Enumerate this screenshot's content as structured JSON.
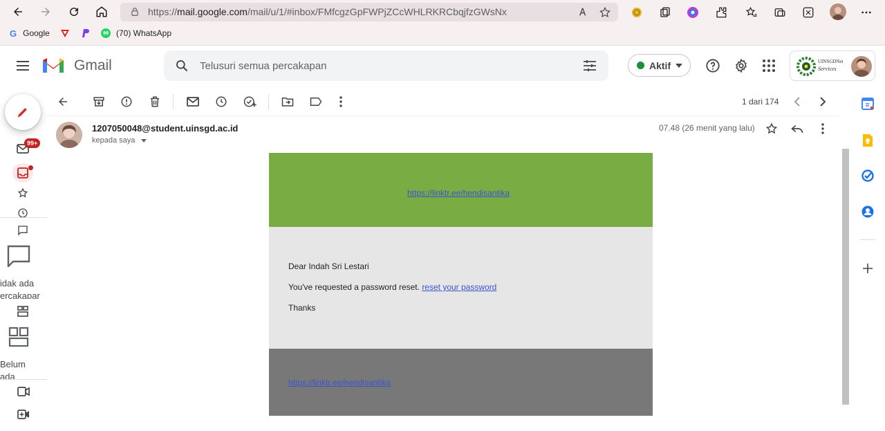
{
  "browser": {
    "url_prefix": "https://",
    "url_host": "mail.google.com",
    "url_path": "/mail/u/1/#inbox/FMfcgzGpFWPjZCcWHLRKRCbqjfzGWsNx",
    "bookmarks": [
      {
        "label": "Google"
      },
      {
        "label": ""
      },
      {
        "label": ""
      },
      {
        "label": "(70) WhatsApp"
      }
    ]
  },
  "gmail": {
    "logo_text": "Gmail",
    "search_placeholder": "Telusuri semua percakapan",
    "status_label": "Aktif",
    "account_org": "UINSGDNet",
    "account_org_sub": "Services"
  },
  "rail": {
    "mail_badge": "99+",
    "chat_empty_line1": "idak ada",
    "chat_empty_line2": "ercakapar",
    "spaces_empty_line1": "Belum",
    "spaces_empty_line2": "ada"
  },
  "toolbar": {
    "pagination": "1 dari 174"
  },
  "message": {
    "sender": "1207050048@student.uinsgd.ac.id",
    "to_me": "kepada saya",
    "time": "07.48 (26 menit yang lalu)",
    "top_link": "https://linktr.ee/hendisantika",
    "greeting": "Dear Indah Sri Lestari",
    "body_text": "You've requested a password reset. ",
    "reset_link": "reset your password",
    "thanks": "Thanks",
    "bottom_link": "https://linktr.ee/hendisantika"
  },
  "colors": {
    "header_green": "#79ac43",
    "body_gray": "#e6e6e6",
    "footer_gray": "#787878",
    "compose_red": "#d93025",
    "badge_red": "#c5221f",
    "active_green": "#1e8e3e"
  }
}
